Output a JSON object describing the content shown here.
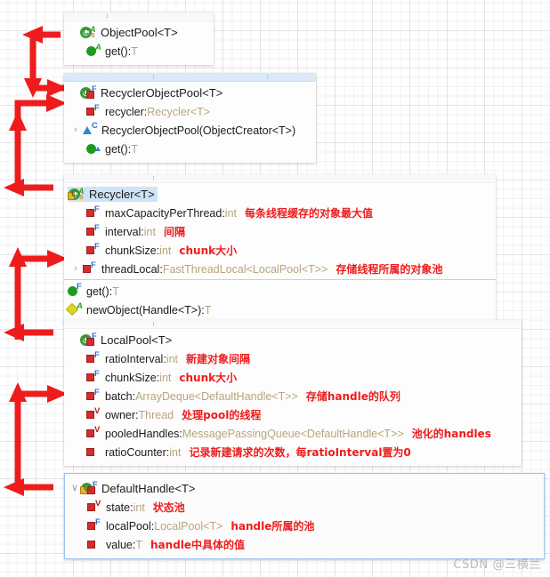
{
  "diagram": {
    "title": "Netty ObjectPool / Recycler class diagram",
    "watermark": "CSDN @三横兰",
    "accent_red": "#ee1c1c",
    "arrow_color": "#ee1c1c",
    "type_color": "#b8a47c",
    "selection_blue": "#cfe3f7"
  },
  "boxes": [
    {
      "id": "object-pool",
      "title": "ObjectPool<T>",
      "title_icon": "class-abstract-static-icon",
      "twisty": "",
      "selected": false,
      "members": [
        {
          "icon": "method-green-abstract-icon",
          "twisty": "",
          "name": "get()",
          "sep": " : ",
          "type": "T",
          "note": ""
        }
      ]
    },
    {
      "id": "recycler-object-pool",
      "title": "RecyclerObjectPool<T>",
      "title_icon": "class-static-final-icon",
      "twisty": "",
      "selected": false,
      "members": [
        {
          "icon": "field-red-final-icon",
          "twisty": "",
          "name": "recycler",
          "sep": " : ",
          "type": "Recycler<T>",
          "note": ""
        },
        {
          "icon": "constructor-blue-icon",
          "twisty": "›",
          "name": "RecyclerObjectPool(ObjectCreator<T>)",
          "sep": "",
          "type": "",
          "note": ""
        },
        {
          "icon": "method-green-override-icon",
          "twisty": "",
          "name": "get()",
          "sep": " : ",
          "type": "T",
          "note": ""
        }
      ]
    },
    {
      "id": "recycler",
      "title": "Recycler<T>",
      "title_icon": "class-abstract-static-locked-icon",
      "title_highlighted": true,
      "twisty": "",
      "selected": false,
      "members": [
        {
          "icon": "field-red-final-icon",
          "twisty": "",
          "name": "maxCapacityPerThread",
          "sep": " : ",
          "type": "int",
          "note": "每条线程缓存的对象最大值"
        },
        {
          "icon": "field-red-final-icon",
          "twisty": "",
          "name": "interval",
          "sep": " : ",
          "type": "int",
          "note": "间隔"
        },
        {
          "icon": "field-red-final-icon",
          "twisty": "",
          "name": "chunkSize",
          "sep": " : ",
          "type": "int",
          "note": "chunk大小"
        },
        {
          "icon": "field-red-final-icon",
          "twisty": "›",
          "name": "threadLocal",
          "sep": " : ",
          "type": "FastThreadLocal<LocalPool<T>>",
          "note": "存储线程所属的对象池"
        }
      ],
      "divider_after_members": true,
      "methods": [
        {
          "icon": "method-green-final-icon",
          "twisty": "",
          "name": "get()",
          "sep": " : ",
          "type": "T",
          "note": ""
        },
        {
          "icon": "method-yellow-abstract-icon",
          "twisty": "",
          "name": "newObject(Handle<T>)",
          "sep": " : ",
          "type": "T",
          "note": ""
        }
      ]
    },
    {
      "id": "local-pool",
      "title": "LocalPool<T>",
      "title_icon": "class-static-final-icon",
      "twisty": "",
      "selected": false,
      "members": [
        {
          "icon": "field-red-final-icon",
          "twisty": "",
          "name": "ratioInterval",
          "sep": " : ",
          "type": "int",
          "note": "新建对象间隔"
        },
        {
          "icon": "field-red-final-icon",
          "twisty": "",
          "name": "chunkSize",
          "sep": " : ",
          "type": "int",
          "note": "chunk大小"
        },
        {
          "icon": "field-red-final-icon",
          "twisty": "",
          "name": "batch",
          "sep": " : ",
          "type": "ArrayDeque<DefaultHandle<T>>",
          "note": "存储handle的队列"
        },
        {
          "icon": "field-red-volatile-icon",
          "twisty": "",
          "name": "owner",
          "sep": " : ",
          "type": "Thread",
          "note": "处理pool的线程"
        },
        {
          "icon": "field-red-volatile-icon",
          "twisty": "",
          "name": "pooledHandles",
          "sep": " : ",
          "type": "MessagePassingQueue<DefaultHandle<T>>",
          "note": "池化的handles"
        },
        {
          "icon": "field-red-icon",
          "twisty": "",
          "name": "ratioCounter",
          "sep": " : ",
          "type": "int",
          "note": "记录新建请求的次数，每ratioInterval置为0"
        }
      ]
    },
    {
      "id": "default-handle",
      "title": "DefaultHandle<T>",
      "title_icon": "class-static-final-locked-icon",
      "twisty": "∨",
      "selected": true,
      "members": [
        {
          "icon": "field-red-volatile-icon",
          "twisty": "",
          "name": "state",
          "sep": " : ",
          "type": "int",
          "note": "状态池"
        },
        {
          "icon": "field-red-final-icon",
          "twisty": "",
          "name": "localPool",
          "sep": " : ",
          "type": "LocalPool<T>",
          "note": "handle所属的池"
        },
        {
          "icon": "field-red-icon",
          "twisty": "",
          "name": "value",
          "sep": " : ",
          "type": "T",
          "note": "handle中具体的值"
        }
      ]
    }
  ],
  "arrows": [
    {
      "name": "arrow-objectpool-up-left",
      "from": "RecyclerObjectPool",
      "to": "ObjectPool"
    },
    {
      "name": "arrow-recycler-to-recyclerobjectpool",
      "from": "Recycler",
      "to": "RecyclerObjectPool"
    },
    {
      "name": "arrow-localpool-to-recycler",
      "from": "LocalPool",
      "to": "Recycler threadLocal"
    },
    {
      "name": "arrow-defaulthandle-to-localpool",
      "from": "DefaultHandle",
      "to": "LocalPool batch"
    }
  ]
}
